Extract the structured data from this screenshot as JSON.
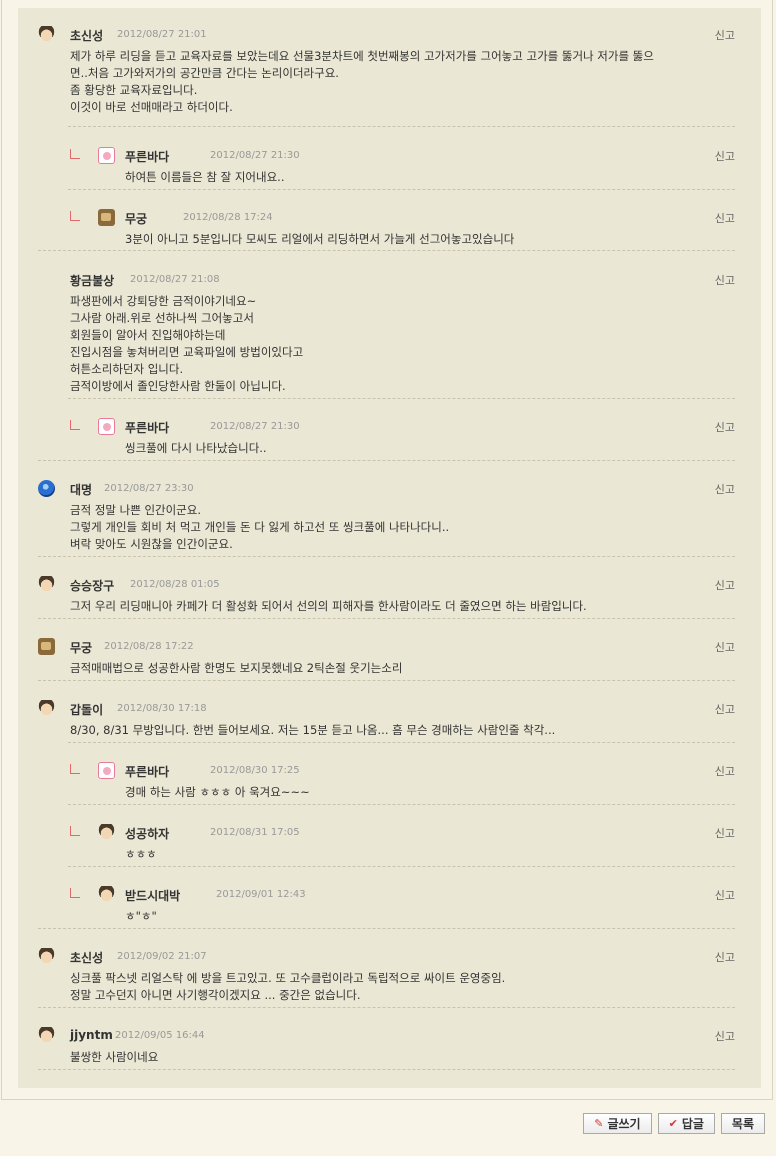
{
  "report_label": "신고",
  "comments": [
    {
      "nick": "초신성",
      "date": "2012/08/27 21:01",
      "avatar": "face",
      "reply": false,
      "lines": [
        "제가 하루 리딩을 듣고 교육자료를 보았는데요 선물3분차트에 첫번째봉의 고가저가를 그어놓고 고가를 뚫거나 저가를 뚫으",
        "면..처음 고가와저가의 공간만큼 간다는 논리이더라구요.",
        "좀 황당한 교육자료입니다.",
        "이것이 바로 선매매라고 하더이다."
      ]
    },
    {
      "nick": "푸른바다",
      "date": "2012/08/27 21:30",
      "avatar": "pink",
      "reply": true,
      "lines": [
        "하여튼 이름들은 참 잘 지어내요.."
      ]
    },
    {
      "nick": "무궁",
      "date": "2012/08/28 17:24",
      "avatar": "brown",
      "reply": true,
      "lines": [
        "3분이 아니고 5분입니다 모씨도 리얼에서 리딩하면서 가늘게 선그어놓고있습니다"
      ]
    },
    {
      "nick": "황금불상",
      "date": "2012/08/27 21:08",
      "avatar": "none",
      "reply": false,
      "lines": [
        "파생판에서 강퇴당한 금적이야기네요~",
        "그사람 아래.위로 선하나씩 그어놓고서",
        "회원들이 알아서 진입해야하는데",
        "진입시점을 놓쳐버리면 교육파일에 방법이있다고",
        "허튼소리하던자 입니다.",
        "금적이방에서 졸인당한사람 한둘이 아닙니다."
      ]
    },
    {
      "nick": "푸른바다",
      "date": "2012/08/27 21:30",
      "avatar": "pink",
      "reply": true,
      "lines": [
        "씽크풀에 다시 나타났습니다.."
      ]
    },
    {
      "nick": "대명",
      "date": "2012/08/27 23:30",
      "avatar": "blue",
      "reply": false,
      "lines": [
        "금적 정말 나쁜 인간이군요.",
        "그렇게 개인들 회비 처 먹고 개인들 돈 다 잃게 하고선 또 씽크풀에 나타나다니..",
        "벼락 맞아도 시원찮을 인간이군요."
      ]
    },
    {
      "nick": "승승장구",
      "date": "2012/08/28 01:05",
      "avatar": "face",
      "reply": false,
      "lines": [
        "그저 우리 리딩매니아 카페가 더 활성화 되어서 선의의 피해자를 한사람이라도 더 줄였으면 하는 바람입니다."
      ]
    },
    {
      "nick": "무궁",
      "date": "2012/08/28 17:22",
      "avatar": "brown",
      "reply": false,
      "lines": [
        "금적매매법으로 성공한사람 한명도 보지못했네요 2틱손절 웃기는소리"
      ]
    },
    {
      "nick": "갑돌이",
      "date": "2012/08/30 17:18",
      "avatar": "face",
      "reply": false,
      "lines": [
        "8/30, 8/31 무방입니다. 한번 들어보세요. 저는 15분 듣고 나옴... 흠 무슨 경매하는 사람인줄 착각..."
      ]
    },
    {
      "nick": "푸른바다",
      "date": "2012/08/30 17:25",
      "avatar": "pink",
      "reply": true,
      "lines": [
        "경매 하는 사람 ㅎㅎㅎ 아 욱겨요~~~"
      ]
    },
    {
      "nick": "성공하자",
      "date": "2012/08/31 17:05",
      "avatar": "face",
      "reply": true,
      "lines": [
        "ㅎㅎㅎ"
      ]
    },
    {
      "nick": "받드시대박",
      "date": "2012/09/01 12:43",
      "avatar": "face",
      "reply": true,
      "lines": [
        "ㅎ\"ㅎ\""
      ]
    },
    {
      "nick": "초신성",
      "date": "2012/09/02 21:07",
      "avatar": "face",
      "reply": false,
      "lines": [
        "싱크풀 팍스넷 리얼스탁 에 방을 트고있고. 또 고수클럽이라고 독립적으로 싸이트 운영중임.",
        "정말 고수던지 아니면 사기행각이겠지요 ... 중간은 없습니다."
      ]
    },
    {
      "nick": "jjyntm",
      "date": "2012/09/05 16:44",
      "avatar": "face",
      "reply": false,
      "lines": [
        "불쌍한 사람이네요"
      ]
    }
  ],
  "buttons": {
    "write": "글쓰기",
    "reply": "답글",
    "list": "목록"
  }
}
